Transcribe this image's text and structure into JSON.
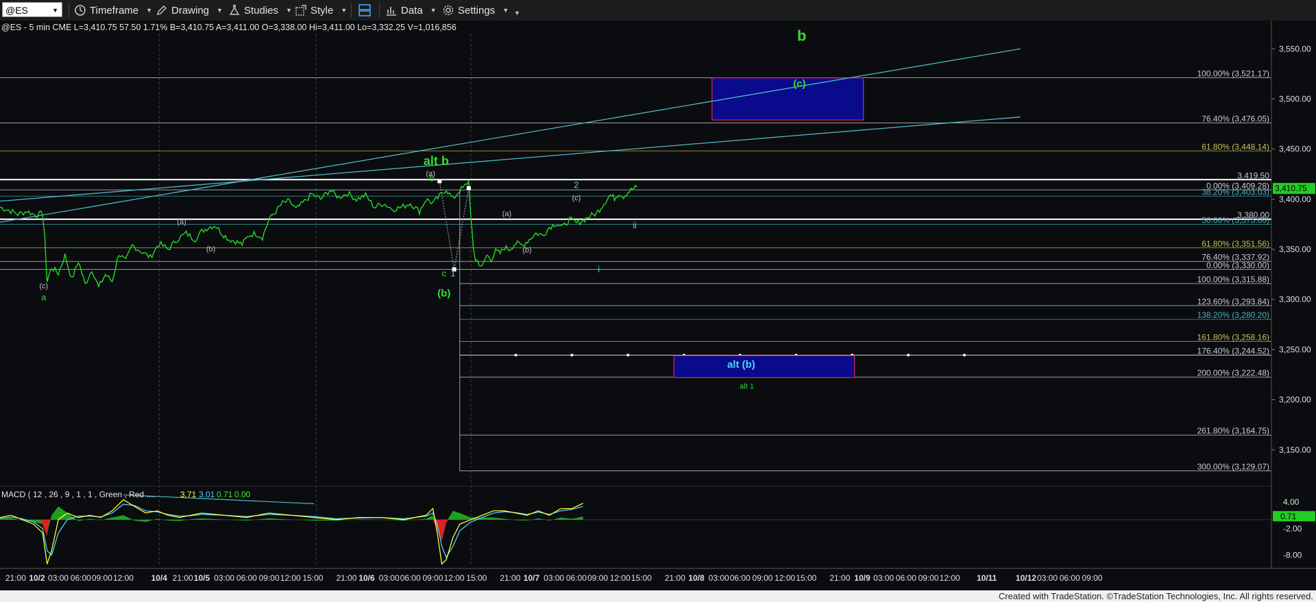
{
  "toolbar": {
    "symbol": "@ES",
    "timeframe_label": "Timeframe",
    "drawing_label": "Drawing",
    "studies_label": "Studies",
    "style_label": "Style",
    "data_label": "Data",
    "settings_label": "Settings"
  },
  "header": {
    "info": "@ES - 5 min  CME  L=3,410.75  57.50  1.71%  B=3,410.75  A=3,411.00  O=3,338.00  Hi=3,411.00  Lo=3,332.25  V=1,016,856"
  },
  "footer": {
    "credit": "Created with TradeStation. ©TradeStation Technologies, Inc. All rights reserved."
  },
  "chart_data": {
    "type": "line",
    "title": "@ES - 5 min",
    "last_price": "3,410.75",
    "price_axis": {
      "ylim": [
        3100,
        3570
      ],
      "ticks": [
        3150,
        3200,
        3250,
        3300,
        3350,
        3400,
        3450,
        3500,
        3550
      ],
      "tick_labels": [
        "3,150.00",
        "3,200.00",
        "3,250.00",
        "3,300.00",
        "3,350.00",
        "3,400.00",
        "3,450.00",
        "3,500.00",
        "3,550.00"
      ]
    },
    "x_axis": {
      "bar_range": [
        0,
        1000
      ],
      "labels": [
        {
          "text": "21:00",
          "bar": 14
        },
        {
          "text": "10/2",
          "bar": 33
        },
        {
          "text": "03:00",
          "bar": 52
        },
        {
          "text": "06:00",
          "bar": 72
        },
        {
          "text": "09:00",
          "bar": 91
        },
        {
          "text": "12:00",
          "bar": 110
        },
        {
          "text": "10/4",
          "bar": 142
        },
        {
          "text": "21:00",
          "bar": 163
        },
        {
          "text": "10/5",
          "bar": 180
        },
        {
          "text": "03:00",
          "bar": 200
        },
        {
          "text": "06:00",
          "bar": 220
        },
        {
          "text": "09:00",
          "bar": 240
        },
        {
          "text": "12:00",
          "bar": 259
        },
        {
          "text": "15:00",
          "bar": 279
        },
        {
          "text": "21:00",
          "bar": 309
        },
        {
          "text": "10/6",
          "bar": 327
        },
        {
          "text": "03:00",
          "bar": 347
        },
        {
          "text": "06:00",
          "bar": 366
        },
        {
          "text": "09:00",
          "bar": 386
        },
        {
          "text": "12:00",
          "bar": 405
        },
        {
          "text": "15:00",
          "bar": 425
        },
        {
          "text": "21:00",
          "bar": 455
        },
        {
          "text": "10/7",
          "bar": 474
        },
        {
          "text": "03:00",
          "bar": 494
        },
        {
          "text": "06:00",
          "bar": 514
        },
        {
          "text": "09:00",
          "bar": 533
        },
        {
          "text": "12:00",
          "bar": 553
        },
        {
          "text": "15:00",
          "bar": 572
        },
        {
          "text": "21:00",
          "bar": 602
        },
        {
          "text": "10/8",
          "bar": 621
        },
        {
          "text": "03:00",
          "bar": 641
        },
        {
          "text": "06:00",
          "bar": 660
        },
        {
          "text": "09:00",
          "bar": 680
        },
        {
          "text": "12:00",
          "bar": 700
        },
        {
          "text": "15:00",
          "bar": 719
        },
        {
          "text": "21:00",
          "bar": 749
        },
        {
          "text": "10/9",
          "bar": 769
        },
        {
          "text": "03:00",
          "bar": 788
        },
        {
          "text": "06:00",
          "bar": 808
        },
        {
          "text": "09:00",
          "bar": 828
        },
        {
          "text": "12:00",
          "bar": 847
        },
        {
          "text": "10/11",
          "bar": 880
        },
        {
          "text": "10/12",
          "bar": 915
        },
        {
          "text": "03:00",
          "bar": 934
        },
        {
          "text": "06:00",
          "bar": 954
        },
        {
          "text": "09:00",
          "bar": 974
        }
      ]
    },
    "price_series": {
      "name": "@ES",
      "x": [
        0,
        8,
        16,
        24,
        32,
        38,
        40,
        42,
        46,
        52,
        58,
        64,
        70,
        76,
        82,
        88,
        94,
        100,
        106,
        112,
        118,
        126,
        134,
        142,
        150,
        158,
        166,
        174,
        180,
        186,
        192,
        198,
        204,
        210,
        216,
        222,
        228,
        234,
        240,
        246,
        252,
        258,
        264,
        270,
        278,
        286,
        294,
        302,
        310,
        318,
        326,
        334,
        342,
        350,
        358,
        366,
        374,
        380,
        386,
        392,
        398,
        404,
        410,
        414,
        418,
        420,
        422,
        424,
        426,
        430,
        434,
        438,
        442,
        446,
        450,
        454,
        460,
        466,
        472,
        478,
        484,
        490,
        496,
        502,
        508,
        514,
        520,
        526,
        532,
        536,
        540,
        544,
        548,
        552,
        556,
        560,
        564,
        568
      ],
      "y": [
        3392,
        3389,
        3385,
        3388,
        3384,
        3386,
        3360,
        3318,
        3332,
        3326,
        3344,
        3320,
        3338,
        3315,
        3330,
        3312,
        3325,
        3318,
        3346,
        3338,
        3354,
        3348,
        3342,
        3356,
        3350,
        3360,
        3366,
        3360,
        3368,
        3372,
        3374,
        3366,
        3360,
        3358,
        3355,
        3364,
        3366,
        3362,
        3380,
        3388,
        3396,
        3398,
        3390,
        3396,
        3405,
        3400,
        3409,
        3402,
        3406,
        3400,
        3404,
        3392,
        3396,
        3390,
        3392,
        3396,
        3388,
        3400,
        3396,
        3403,
        3410,
        3400,
        3409,
        3412,
        3418,
        3380,
        3352,
        3340,
        3338,
        3332,
        3344,
        3340,
        3348,
        3346,
        3352,
        3350,
        3356,
        3354,
        3360,
        3366,
        3364,
        3372,
        3376,
        3372,
        3380,
        3376,
        3379,
        3383,
        3386,
        3392,
        3398,
        3404,
        3401,
        3406,
        3403,
        3407,
        3410,
        3412
      ]
    },
    "fib_levels": [
      {
        "label": "100.00% (3,521.17)",
        "value": 3521.17
      },
      {
        "label": "76.40% (3,476.05)",
        "value": 3476.05
      },
      {
        "label": "61.80% (3,448.14)",
        "value": 3448.14
      },
      {
        "label": "3,419.50",
        "value": 3419.5
      },
      {
        "label": "0.00% (3,409.28)",
        "value": 3409.28
      },
      {
        "label": "38.20% (3,403.03)",
        "value": 3403.03
      },
      {
        "label": "3,380.00",
        "value": 3380.0
      },
      {
        "label": "50.00% (3,375.00)",
        "value": 3375.0
      },
      {
        "label": "61.80% (3,351.56)",
        "value": 3351.56
      },
      {
        "label": "76.40% (3,337.92)",
        "value": 3337.92
      },
      {
        "label": "0.00% (3,330.00)",
        "value": 3330.0
      },
      {
        "label": "100.00% (3,315.88)",
        "value": 3315.88
      },
      {
        "label": "123.60% (3,293.84)",
        "value": 3293.84
      },
      {
        "label": "138.20% (3,280.20)",
        "value": 3280.2
      },
      {
        "label": "161.80% (3,258.16)",
        "value": 3258.16
      },
      {
        "label": "176.40% (3,244.52)",
        "value": 3244.52
      },
      {
        "label": "200.00% (3,222.48)",
        "value": 3222.48
      },
      {
        "label": "261.80% (3,164.75)",
        "value": 3164.75
      },
      {
        "label": "300.00% (3,129.07)",
        "value": 3129.07
      }
    ],
    "boxes": [
      {
        "label": "(c)",
        "x_range": [
          635,
          770
        ],
        "y_range": [
          3479,
          3521
        ]
      },
      {
        "label": "alt (b)",
        "x_range": [
          601,
          762
        ],
        "y_range": [
          3222,
          3244
        ]
      }
    ],
    "trendlines": [
      {
        "points": [
          [
            0,
            3377
          ],
          [
            910,
            3550
          ]
        ]
      },
      {
        "points": [
          [
            0,
            3398
          ],
          [
            910,
            3482
          ]
        ]
      }
    ],
    "wave_labels": [
      {
        "text": "b",
        "x": 715,
        "y": 3558,
        "color": "green"
      },
      {
        "text": "(c)",
        "x": 713,
        "y": 3512,
        "color": "green"
      },
      {
        "text": "alt b",
        "x": 389,
        "y": 3434,
        "color": "green"
      },
      {
        "text": "b",
        "x": 385,
        "y": 3418,
        "color": "green"
      },
      {
        "text": "(a)",
        "x": 384,
        "y": 3423,
        "color": "gray"
      },
      {
        "text": "2",
        "x": 514,
        "y": 3411,
        "color": "blue"
      },
      {
        "text": "(c)",
        "x": 514,
        "y": 3399,
        "color": "gray"
      },
      {
        "text": "(a)",
        "x": 452,
        "y": 3383,
        "color": "gray"
      },
      {
        "text": "(b)",
        "x": 470,
        "y": 3347,
        "color": "gray"
      },
      {
        "text": "ii",
        "x": 566,
        "y": 3371,
        "color": "blue"
      },
      {
        "text": "i",
        "x": 534,
        "y": 3327,
        "color": "blue"
      },
      {
        "text": "c",
        "x": 396,
        "y": 3323,
        "color": "green"
      },
      {
        "text": "1",
        "x": 404,
        "y": 3323,
        "color": "blue"
      },
      {
        "text": "(b)",
        "x": 396,
        "y": 3303,
        "color": "green"
      },
      {
        "text": "(a)",
        "x": 162,
        "y": 3375,
        "color": "gray"
      },
      {
        "text": "(b)",
        "x": 188,
        "y": 3348,
        "color": "gray"
      },
      {
        "text": "(c)",
        "x": 39,
        "y": 3311,
        "color": "gray"
      },
      {
        "text": "a",
        "x": 39,
        "y": 3299,
        "color": "green"
      },
      {
        "text": "alt (b)",
        "x": 661,
        "y": 3232,
        "color": "blue"
      },
      {
        "text": "alt 1",
        "x": 666,
        "y": 3211,
        "color": "green"
      }
    ],
    "macd": {
      "title": "MACD ( 12 , 26 , 9 , 1 , 1 , Green , Red ....",
      "values": [
        "3.71",
        "3.01",
        "0.71",
        "0.00"
      ],
      "ylim": [
        -11,
        6
      ],
      "ticks": [
        4.0,
        -2.0,
        -8.0
      ],
      "tick_labels": [
        "4.00",
        "-2.00",
        "-8.00"
      ],
      "current": "0.71",
      "macd_line": {
        "x": [
          0,
          10,
          20,
          30,
          38,
          42,
          46,
          52,
          60,
          70,
          80,
          90,
          100,
          110,
          120,
          130,
          140,
          150,
          160,
          170,
          180,
          200,
          220,
          240,
          260,
          280,
          300,
          320,
          340,
          360,
          380,
          386,
          390,
          394,
          398,
          404,
          410,
          420,
          430,
          440,
          450,
          460,
          470,
          480,
          490,
          500,
          510,
          520
        ],
        "y": [
          0.5,
          1,
          0,
          -1,
          -3,
          -10,
          -7,
          0,
          1.5,
          0.5,
          1,
          0.5,
          2,
          4.5,
          3,
          1.5,
          2,
          1,
          0.5,
          1,
          1.5,
          1,
          0.5,
          1.5,
          1,
          0.5,
          0,
          0.5,
          0.5,
          0,
          1,
          2.5,
          -3,
          -10,
          -9,
          -4,
          -1,
          0,
          1,
          2,
          2,
          1.5,
          1,
          2,
          1,
          2.5,
          2.5,
          3.7
        ]
      },
      "signal_line": {
        "x": [
          0,
          10,
          20,
          30,
          38,
          42,
          46,
          52,
          60,
          70,
          80,
          90,
          100,
          110,
          120,
          130,
          140,
          150,
          160,
          170,
          180,
          200,
          220,
          240,
          260,
          280,
          300,
          320,
          340,
          360,
          380,
          386,
          390,
          394,
          398,
          404,
          410,
          420,
          430,
          440,
          450,
          460,
          470,
          480,
          490,
          500,
          510,
          520
        ],
        "y": [
          0.3,
          0.6,
          0.2,
          -0.5,
          -2,
          -7,
          -8,
          -3,
          0,
          0.8,
          0.8,
          0.6,
          1.5,
          3.5,
          3.2,
          2,
          1.8,
          1.2,
          0.8,
          0.9,
          1.2,
          1,
          0.7,
          1.2,
          1,
          0.7,
          0.2,
          0.4,
          0.5,
          0.2,
          0.8,
          1.5,
          -1,
          -6,
          -8.5,
          -6,
          -2.5,
          -0.5,
          0.5,
          1.5,
          1.8,
          1.6,
          1.2,
          1.7,
          1.2,
          2,
          2.3,
          3.0
        ]
      },
      "histogram": {
        "x": [
          0,
          10,
          20,
          30,
          38,
          42,
          46,
          52,
          60,
          70,
          80,
          90,
          100,
          110,
          120,
          130,
          140,
          150,
          160,
          170,
          180,
          200,
          220,
          240,
          260,
          280,
          300,
          320,
          340,
          360,
          380,
          386,
          390,
          394,
          398,
          404,
          410,
          420,
          430,
          440,
          450,
          460,
          470,
          480,
          490,
          500,
          510,
          520
        ],
        "y": [
          0.2,
          0.4,
          -0.2,
          -0.5,
          -1,
          -3,
          1,
          3,
          1.5,
          -0.3,
          0.2,
          -0.1,
          0.5,
          1,
          -0.2,
          -0.5,
          0.2,
          -0.2,
          -0.3,
          0.1,
          0.3,
          0,
          -0.2,
          0.3,
          0,
          -0.2,
          -0.2,
          0.1,
          0,
          -0.2,
          0.2,
          1,
          -2,
          -4,
          -0.5,
          2,
          1.5,
          0.5,
          0.5,
          0.5,
          0.2,
          -0.1,
          -0.2,
          0.3,
          -0.2,
          0.5,
          0.2,
          0.7
        ]
      }
    }
  }
}
